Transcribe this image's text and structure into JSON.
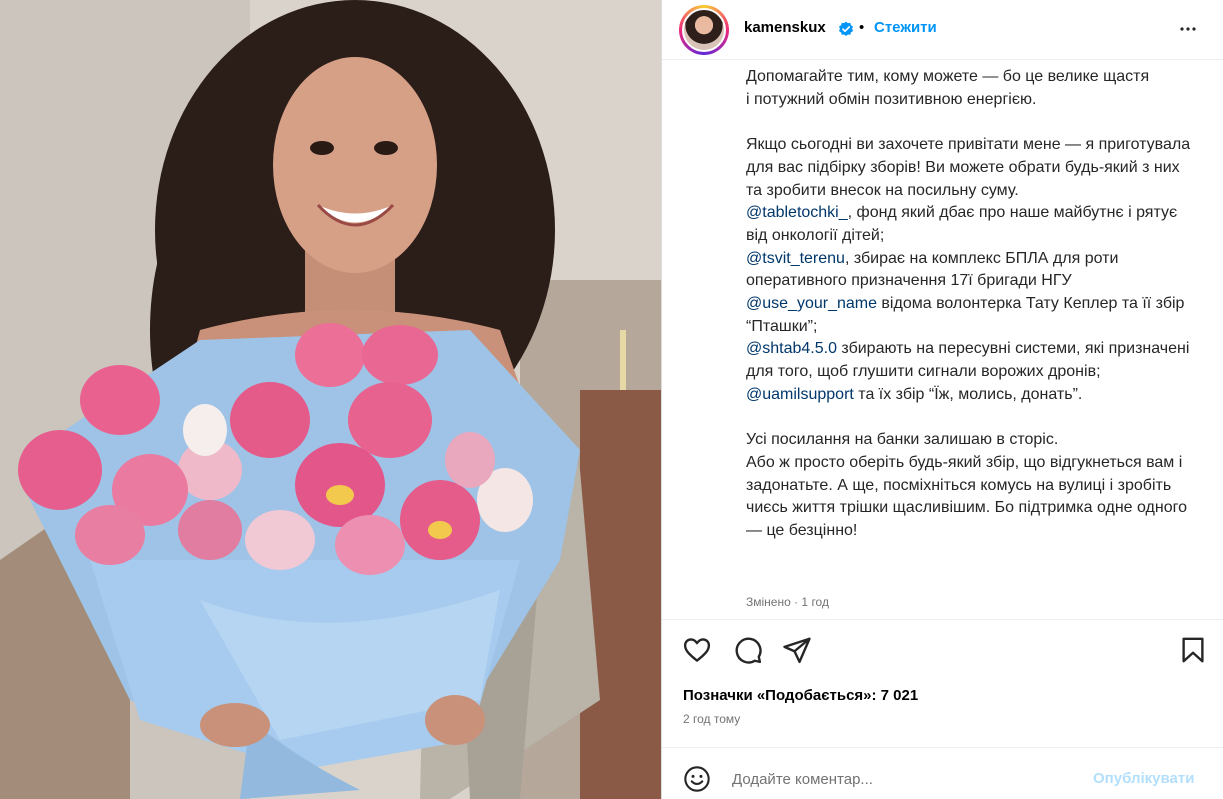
{
  "header": {
    "username": "kamenskux",
    "separator": "•",
    "follow_label": "Стежити"
  },
  "caption": {
    "p1": "Допомагайте тим, кому можете — бо це велике щастя\nі потужний обмін позитивною енергією.",
    "p2_intro": "Якщо сьогодні ви захочете привітати мене — я приготувала для вас підбірку зборів! Ви можете обрати будь-який з них та зробити внесок на посильну суму.",
    "m1": "@tabletochki_",
    "t1": ", фонд який дбає про наше майбутнє і рятує від онкології дітей;",
    "m2": "@tsvit_terenu",
    "t2": ", збирає на комплекс БПЛА для роти оперативного призначення 17ї бригади НГУ",
    "m3": "@use_your_name",
    "t3": " відома волонтерка Тату Кеплер та її збір “Пташки”;",
    "m4": "@shtab4.5.0",
    "t4": " збирають на пересувні системи, які призначені для того, щоб глушити сигнали ворожих дронів;",
    "m5": "@uamilsupport",
    "t5": " та їх збір “Їж, молись, донать”.",
    "p3": "Усі посилання на банки залишаю в сторіс.\nАбо ж просто оберіть будь-який збір, що відгукнеться вам і задонатьте. А ще, посміхніться комусь на вулиці і зробіть чиєсь життя трішки щасливішим. Бо підтримка одне одного — це безцінно!"
  },
  "meta": "Змінено · 1 год",
  "likes": "Позначки «Подобається»: 7 021",
  "time_ago": "2 год тому",
  "comment": {
    "placeholder": "Додайте коментар...",
    "publish_label": "Опублікувати"
  },
  "colors": {
    "link_blue": "#0095f6",
    "mention": "#00376b",
    "publish_disabled": "#b2dffc",
    "verified": "#0095f6"
  },
  "icons": [
    "verified-icon",
    "more-options-icon",
    "heart-icon",
    "comment-icon",
    "share-icon",
    "bookmark-icon",
    "emoji-icon"
  ]
}
